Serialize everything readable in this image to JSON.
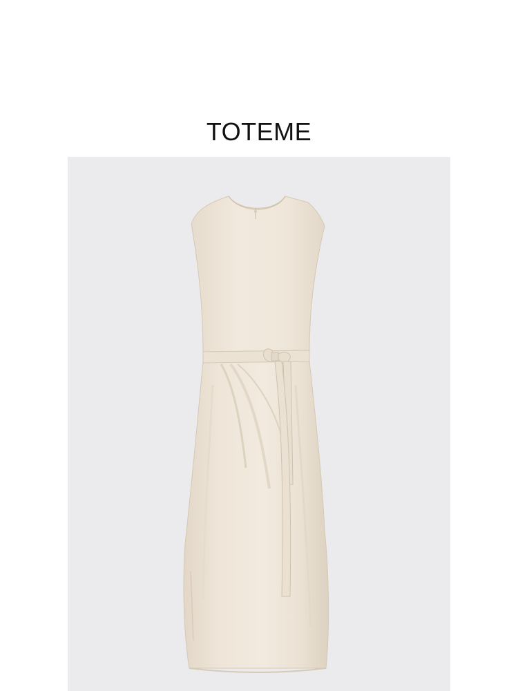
{
  "brand": {
    "name": "TOTEME"
  },
  "product_photo": {
    "subject": "dress",
    "background_color": "#ebebed",
    "garment_color": "#efe7da"
  }
}
